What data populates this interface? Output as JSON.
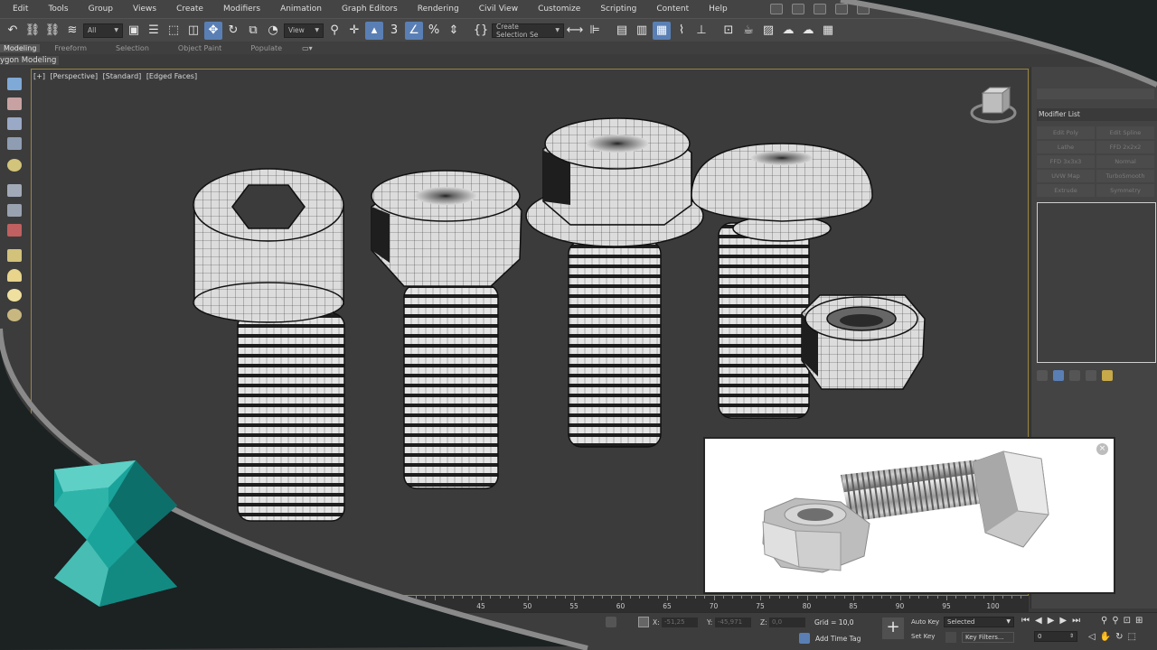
{
  "menu": [
    "Edit",
    "Tools",
    "Group",
    "Views",
    "Create",
    "Modifiers",
    "Animation",
    "Graph Editors",
    "Rendering",
    "Civil View",
    "Customize",
    "Scripting",
    "Content",
    "Help"
  ],
  "toolbar": {
    "filter_value": "All",
    "refcoord_value": "View",
    "selection_set_value": "Create Selection Se"
  },
  "ribbon": {
    "tabs": [
      "Modeling",
      "Freeform",
      "Selection",
      "Object Paint",
      "Populate"
    ],
    "active_tab": "Modeling",
    "sub_label": "ygon Modeling"
  },
  "viewport": {
    "label_plus": "[+]",
    "label_view": "[Perspective]",
    "label_shading": "[Standard]",
    "label_edges": "[Edged Faces]"
  },
  "command_panel": {
    "modifier_list_label": "Modifier List",
    "modifier_buttons": [
      "Edit Poly",
      "Edit Spline",
      "Lathe",
      "FFD 2x2x2",
      "FFD 3x3x3",
      "Normal",
      "UVW Map",
      "TurboSmooth",
      "Extrude",
      "Symmetry"
    ]
  },
  "timeline": {
    "ticks": [
      "45",
      "50",
      "55",
      "60",
      "65",
      "70",
      "75",
      "80",
      "85",
      "90",
      "95",
      "100"
    ]
  },
  "status": {
    "x_label": "X:",
    "x_value": "-51,25",
    "y_label": "Y:",
    "y_value": "-45,971",
    "z_label": "Z:",
    "z_value": "0,0",
    "grid_text": "Grid = 10,0",
    "add_time_tag": "Add Time Tag",
    "auto_key": "Auto Key",
    "set_key": "Set Key",
    "key_mode_value": "Selected",
    "key_filters": "Key Filters...",
    "frame_value": "0"
  },
  "popup": {
    "close_glyph": "×"
  },
  "colors": {
    "viewport_border": "#9a8540",
    "active_tool": "#5a7fb5",
    "logo_teal": "#1aa39a"
  }
}
